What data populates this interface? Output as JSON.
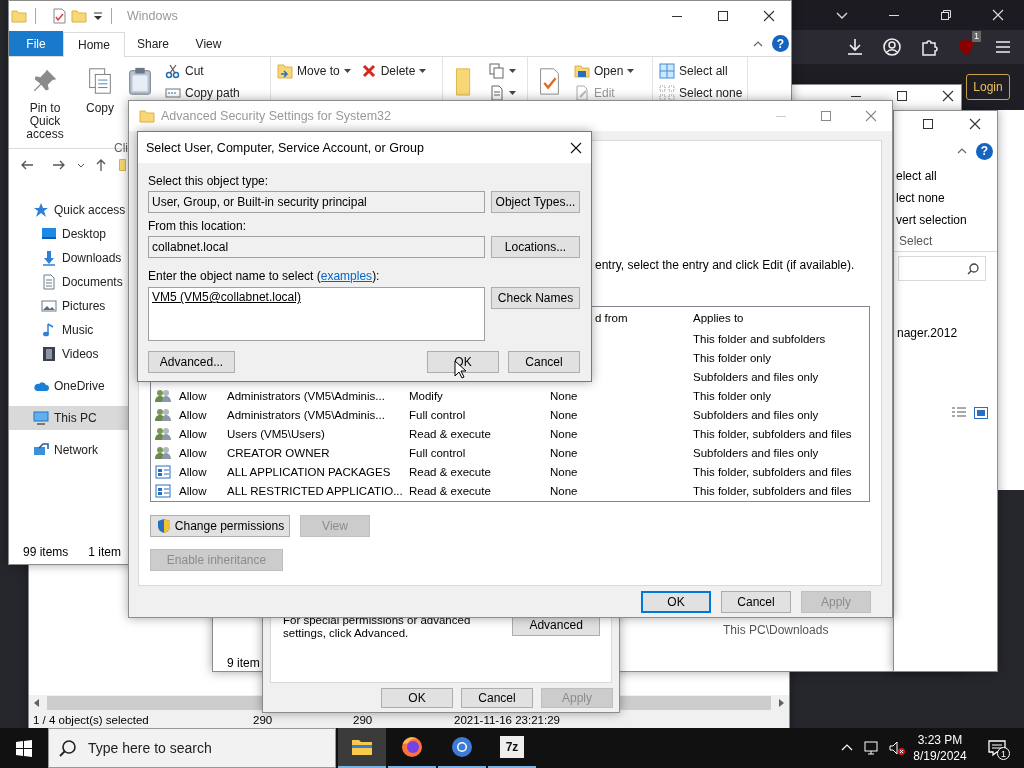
{
  "browser": {
    "extension_badge": "1",
    "login_button": "Login"
  },
  "archive_window": {
    "status_cells": [
      "1 / 4 object(s) selected",
      "290",
      "290",
      "2021-11-16 23:21:29"
    ]
  },
  "downloads_window": {
    "file_name": "nager.2012",
    "location": "This PC\\Downloads",
    "item_count": "9 item"
  },
  "select_ribbon_window": {
    "help_button": "?",
    "commands": [
      "elect all",
      "lect none",
      "vert selection"
    ],
    "group_label": "Select"
  },
  "explorer": {
    "title": "Windows",
    "help_button": "?",
    "tabs": [
      {
        "label": "File",
        "kind": "file",
        "selected": false
      },
      {
        "label": "Home",
        "kind": "tab",
        "selected": true
      },
      {
        "label": "Share",
        "kind": "tab",
        "selected": false
      },
      {
        "label": "View",
        "kind": "tab",
        "selected": false
      }
    ],
    "ribbon": [
      {
        "label": "Cli",
        "columns": [
          {
            "kind": "large",
            "label": "Pin to Quick access"
          },
          {
            "kind": "large",
            "label": "Copy"
          },
          {
            "kind": "large"
          },
          {
            "kind": "stack",
            "items": [
              {
                "label": "Cut"
              },
              {
                "label": "Copy path"
              }
            ]
          }
        ]
      },
      {
        "columns": [
          {
            "kind": "stack",
            "items": [
              {
                "label": "Move to",
                "dropdown": true
              }
            ]
          },
          {
            "kind": "stack",
            "items": [
              {
                "label": "Delete",
                "dropdown": true
              }
            ]
          }
        ]
      },
      {
        "columns": [
          {
            "kind": "large"
          },
          {
            "kind": "stack",
            "items": [
              {
                "dropdown": true
              },
              {
                "dropdown": true
              }
            ]
          }
        ]
      },
      {
        "columns": [
          {
            "kind": "large"
          },
          {
            "kind": "stack",
            "items": [
              {
                "label": "Open",
                "dropdown": true
              },
              {
                "label": "Edit",
                "disabled": true
              }
            ]
          }
        ]
      },
      {
        "columns": [
          {
            "kind": "stack",
            "items": [
              {
                "label": "Select all"
              },
              {
                "label": "Select none"
              }
            ]
          }
        ]
      }
    ],
    "sidebar": [
      {
        "label": "Quick access",
        "selected": false,
        "children": [
          {
            "label": "Desktop",
            "selected": false
          },
          {
            "label": "Downloads",
            "selected": false
          },
          {
            "label": "Documents",
            "selected": false
          },
          {
            "label": "Pictures",
            "selected": false
          },
          {
            "label": "Music",
            "selected": false
          },
          {
            "label": "Videos",
            "selected": false
          }
        ]
      },
      {
        "label": "OneDrive",
        "selected": false
      },
      {
        "label": "This PC",
        "selected": true
      },
      {
        "label": "Network",
        "selected": false
      }
    ],
    "status": [
      "99 items",
      "1 item"
    ]
  },
  "properties_window": {
    "note": "For special permissions or advanced settings, click Advanced.",
    "advanced_button": "Advanced",
    "buttons": [
      {
        "label": "OK",
        "disabled": false
      },
      {
        "label": "Cancel",
        "disabled": false
      },
      {
        "label": "Apply",
        "disabled": true
      }
    ]
  },
  "advanced_security": {
    "title": "Advanced Security Settings for System32",
    "instruction": "entry, select the entry and click Edit (if available).",
    "columns": {
      "inherited_from": "d from",
      "applies_to": "Applies to"
    },
    "rows": [
      {
        "applies_to": "This folder and subfolders"
      },
      {
        "applies_to": "This folder only"
      },
      {
        "applies_to": "Subfolders and files only"
      },
      {
        "kind": "group",
        "type": "Allow",
        "principal": "Administrators (VM5\\Adminis...",
        "access": "Modify",
        "inherited_from": "None",
        "applies_to": "This folder only"
      },
      {
        "kind": "group",
        "type": "Allow",
        "principal": "Administrators (VM5\\Adminis...",
        "access": "Full control",
        "inherited_from": "None",
        "applies_to": "Subfolders and files only"
      },
      {
        "kind": "group",
        "type": "Allow",
        "principal": "Users (VM5\\Users)",
        "access": "Read & execute",
        "inherited_from": "None",
        "applies_to": "This folder, subfolders and files"
      },
      {
        "kind": "group",
        "type": "Allow",
        "principal": "CREATOR OWNER",
        "access": "Full control",
        "inherited_from": "None",
        "applies_to": "Subfolders and files only"
      },
      {
        "kind": "package",
        "type": "Allow",
        "principal": "ALL APPLICATION PACKAGES",
        "access": "Read & execute",
        "inherited_from": "None",
        "applies_to": "This folder, subfolders and files"
      },
      {
        "kind": "package",
        "type": "Allow",
        "principal": "ALL RESTRICTED APPLICATIO...",
        "access": "Read & execute",
        "inherited_from": "None",
        "applies_to": "This folder, subfolders and files"
      }
    ],
    "change_permissions_button": "Change permissions",
    "view_button": {
      "label": "View",
      "disabled": true
    },
    "enable_inheritance_button": {
      "label": "Enable inheritance",
      "disabled": true
    },
    "footer_buttons": [
      {
        "label": "OK",
        "default": true,
        "disabled": false
      },
      {
        "label": "Cancel",
        "default": false,
        "disabled": false
      },
      {
        "label": "Apply",
        "default": false,
        "disabled": true
      }
    ]
  },
  "select_dialog": {
    "title": "Select User, Computer, Service Account, or Group",
    "object_type_label": "Select this object type:",
    "object_type": "User, Group, or Built-in security principal",
    "object_types_button": "Object Types...",
    "location_label": "From this location:",
    "location": "collabnet.local",
    "locations_button": "Locations...",
    "name_label": {
      "before": "Enter the object name to select (",
      "link": "examples",
      "after": "):"
    },
    "names": "VM5 (VM5@collabnet.local)",
    "check_names_button": "Check Names",
    "advanced_button": "Advanced...",
    "ok_button": "OK",
    "cancel_button": "Cancel"
  },
  "taskbar": {
    "search_placeholder": "Type here to search",
    "apps": [
      {
        "kind": "explorer",
        "active": true
      },
      {
        "kind": "firefox",
        "active": false
      },
      {
        "kind": "chrome",
        "active": false
      },
      {
        "kind": "archiver",
        "label": "7z",
        "active": false
      }
    ],
    "time": "3:23 PM",
    "date": "8/19/2024",
    "notification_count": "1"
  }
}
